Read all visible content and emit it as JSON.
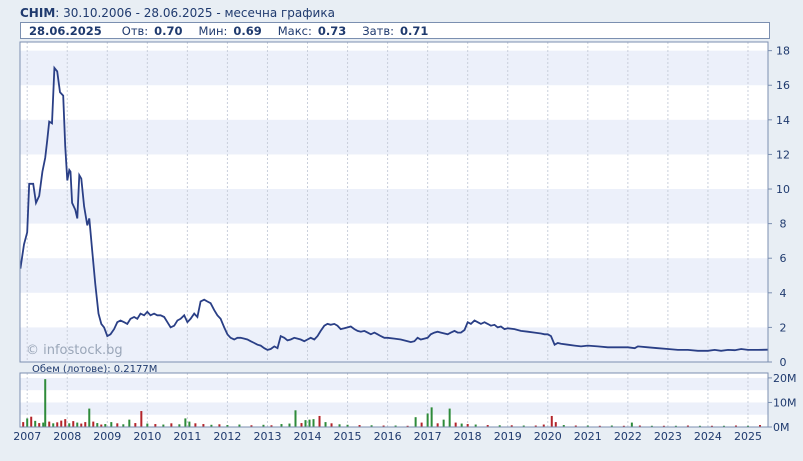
{
  "header": {
    "symbol": "CHIM",
    "range": "30.10.2006 - 28.06.2025",
    "chart_kind": "месечна графика"
  },
  "stats": {
    "date": "28.06.2025",
    "open_label": "Отв:",
    "open": "0.70",
    "min_label": "Мин:",
    "min": "0.69",
    "max_label": "Макс:",
    "max": "0.73",
    "close_label": "Затв:",
    "close": "0.71"
  },
  "watermark": "© infostock.bg",
  "volume_label": "Обем (лотове): 0.2177M",
  "colors": {
    "line": "#2a3f86",
    "vol_up": "#2e8b3a",
    "vol_down": "#b3242a",
    "band": "#ecf0fa",
    "frame": "#7b8fb0",
    "text": "#1f3a6e"
  },
  "chart_data": {
    "type": "line",
    "x_ticks": [
      "2007",
      "2008",
      "2009",
      "2010",
      "2011",
      "2012",
      "2013",
      "2014",
      "2015",
      "2016",
      "2017",
      "2018",
      "2019",
      "2020",
      "2021",
      "2022",
      "2023",
      "2024",
      "2025"
    ],
    "y_ticks": [
      "0",
      "2",
      "4",
      "6",
      "8",
      "10",
      "12",
      "14",
      "16",
      "18"
    ],
    "ylim": [
      0,
      18.5
    ],
    "xlim": [
      2006.82,
      2025.5
    ],
    "series": [
      {
        "values": [
          [
            2006.83,
            5.4
          ],
          [
            2006.92,
            6.8
          ],
          [
            2007.0,
            7.5
          ],
          [
            2007.05,
            10.3
          ],
          [
            2007.15,
            10.3
          ],
          [
            2007.22,
            9.2
          ],
          [
            2007.3,
            9.6
          ],
          [
            2007.38,
            11.0
          ],
          [
            2007.45,
            11.8
          ],
          [
            2007.5,
            12.8
          ],
          [
            2007.55,
            13.9
          ],
          [
            2007.62,
            13.8
          ],
          [
            2007.68,
            17.0
          ],
          [
            2007.75,
            16.8
          ],
          [
            2007.82,
            15.6
          ],
          [
            2007.9,
            15.4
          ],
          [
            2007.95,
            12.5
          ],
          [
            2008.0,
            10.5
          ],
          [
            2008.05,
            11.1
          ],
          [
            2008.08,
            11.0
          ],
          [
            2008.12,
            9.2
          ],
          [
            2008.2,
            8.8
          ],
          [
            2008.25,
            8.3
          ],
          [
            2008.3,
            10.8
          ],
          [
            2008.35,
            10.6
          ],
          [
            2008.42,
            9.0
          ],
          [
            2008.5,
            7.9
          ],
          [
            2008.55,
            8.3
          ],
          [
            2008.62,
            6.5
          ],
          [
            2008.7,
            4.5
          ],
          [
            2008.78,
            2.8
          ],
          [
            2008.85,
            2.2
          ],
          [
            2008.92,
            2.0
          ],
          [
            2009.0,
            1.5
          ],
          [
            2009.08,
            1.6
          ],
          [
            2009.17,
            1.9
          ],
          [
            2009.25,
            2.3
          ],
          [
            2009.33,
            2.4
          ],
          [
            2009.42,
            2.3
          ],
          [
            2009.5,
            2.2
          ],
          [
            2009.58,
            2.5
          ],
          [
            2009.67,
            2.6
          ],
          [
            2009.75,
            2.5
          ],
          [
            2009.83,
            2.8
          ],
          [
            2009.92,
            2.7
          ],
          [
            2010.0,
            2.9
          ],
          [
            2010.08,
            2.7
          ],
          [
            2010.17,
            2.8
          ],
          [
            2010.25,
            2.7
          ],
          [
            2010.33,
            2.7
          ],
          [
            2010.42,
            2.6
          ],
          [
            2010.5,
            2.3
          ],
          [
            2010.58,
            2.0
          ],
          [
            2010.67,
            2.1
          ],
          [
            2010.75,
            2.4
          ],
          [
            2010.83,
            2.5
          ],
          [
            2010.92,
            2.7
          ],
          [
            2011.0,
            2.3
          ],
          [
            2011.08,
            2.5
          ],
          [
            2011.17,
            2.8
          ],
          [
            2011.25,
            2.6
          ],
          [
            2011.33,
            3.5
          ],
          [
            2011.42,
            3.6
          ],
          [
            2011.5,
            3.5
          ],
          [
            2011.58,
            3.4
          ],
          [
            2011.67,
            3.0
          ],
          [
            2011.75,
            2.7
          ],
          [
            2011.83,
            2.5
          ],
          [
            2011.92,
            2.0
          ],
          [
            2012.0,
            1.6
          ],
          [
            2012.08,
            1.4
          ],
          [
            2012.17,
            1.3
          ],
          [
            2012.25,
            1.4
          ],
          [
            2012.33,
            1.4
          ],
          [
            2012.42,
            1.35
          ],
          [
            2012.5,
            1.3
          ],
          [
            2012.58,
            1.2
          ],
          [
            2012.67,
            1.1
          ],
          [
            2012.75,
            1.0
          ],
          [
            2012.83,
            0.95
          ],
          [
            2012.92,
            0.8
          ],
          [
            2013.0,
            0.7
          ],
          [
            2013.08,
            0.75
          ],
          [
            2013.17,
            0.9
          ],
          [
            2013.25,
            0.8
          ],
          [
            2013.33,
            1.5
          ],
          [
            2013.42,
            1.4
          ],
          [
            2013.5,
            1.25
          ],
          [
            2013.58,
            1.3
          ],
          [
            2013.67,
            1.4
          ],
          [
            2013.75,
            1.35
          ],
          [
            2013.83,
            1.3
          ],
          [
            2013.92,
            1.2
          ],
          [
            2014.0,
            1.3
          ],
          [
            2014.08,
            1.4
          ],
          [
            2014.17,
            1.3
          ],
          [
            2014.25,
            1.5
          ],
          [
            2014.33,
            1.8
          ],
          [
            2014.42,
            2.1
          ],
          [
            2014.5,
            2.2
          ],
          [
            2014.58,
            2.15
          ],
          [
            2014.67,
            2.2
          ],
          [
            2014.75,
            2.1
          ],
          [
            2014.83,
            1.9
          ],
          [
            2014.92,
            1.95
          ],
          [
            2015.0,
            2.0
          ],
          [
            2015.08,
            2.05
          ],
          [
            2015.17,
            1.9
          ],
          [
            2015.25,
            1.8
          ],
          [
            2015.33,
            1.75
          ],
          [
            2015.42,
            1.8
          ],
          [
            2015.5,
            1.7
          ],
          [
            2015.58,
            1.6
          ],
          [
            2015.67,
            1.7
          ],
          [
            2015.75,
            1.6
          ],
          [
            2015.83,
            1.5
          ],
          [
            2015.92,
            1.4
          ],
          [
            2016.0,
            1.4
          ],
          [
            2016.17,
            1.35
          ],
          [
            2016.33,
            1.3
          ],
          [
            2016.5,
            1.2
          ],
          [
            2016.58,
            1.15
          ],
          [
            2016.67,
            1.2
          ],
          [
            2016.75,
            1.4
          ],
          [
            2016.83,
            1.3
          ],
          [
            2016.92,
            1.35
          ],
          [
            2017.0,
            1.4
          ],
          [
            2017.08,
            1.6
          ],
          [
            2017.17,
            1.7
          ],
          [
            2017.25,
            1.75
          ],
          [
            2017.33,
            1.7
          ],
          [
            2017.42,
            1.65
          ],
          [
            2017.5,
            1.6
          ],
          [
            2017.58,
            1.7
          ],
          [
            2017.67,
            1.8
          ],
          [
            2017.75,
            1.7
          ],
          [
            2017.83,
            1.7
          ],
          [
            2017.92,
            1.85
          ],
          [
            2018.0,
            2.3
          ],
          [
            2018.08,
            2.2
          ],
          [
            2018.17,
            2.4
          ],
          [
            2018.25,
            2.3
          ],
          [
            2018.33,
            2.2
          ],
          [
            2018.42,
            2.3
          ],
          [
            2018.5,
            2.2
          ],
          [
            2018.58,
            2.1
          ],
          [
            2018.67,
            2.15
          ],
          [
            2018.75,
            2.0
          ],
          [
            2018.83,
            2.05
          ],
          [
            2018.92,
            1.9
          ],
          [
            2019.0,
            1.95
          ],
          [
            2019.17,
            1.9
          ],
          [
            2019.33,
            1.8
          ],
          [
            2019.5,
            1.75
          ],
          [
            2019.67,
            1.7
          ],
          [
            2019.83,
            1.65
          ],
          [
            2019.92,
            1.6
          ],
          [
            2020.0,
            1.6
          ],
          [
            2020.08,
            1.5
          ],
          [
            2020.17,
            1.0
          ],
          [
            2020.25,
            1.1
          ],
          [
            2020.33,
            1.05
          ],
          [
            2020.5,
            1.0
          ],
          [
            2020.67,
            0.95
          ],
          [
            2020.83,
            0.9
          ],
          [
            2021.0,
            0.95
          ],
          [
            2021.25,
            0.9
          ],
          [
            2021.5,
            0.85
          ],
          [
            2021.75,
            0.85
          ],
          [
            2022.0,
            0.85
          ],
          [
            2022.17,
            0.8
          ],
          [
            2022.25,
            0.9
          ],
          [
            2022.5,
            0.85
          ],
          [
            2022.75,
            0.8
          ],
          [
            2023.0,
            0.75
          ],
          [
            2023.25,
            0.7
          ],
          [
            2023.5,
            0.7
          ],
          [
            2023.75,
            0.65
          ],
          [
            2024.0,
            0.65
          ],
          [
            2024.17,
            0.7
          ],
          [
            2024.33,
            0.65
          ],
          [
            2024.5,
            0.7
          ],
          [
            2024.67,
            0.68
          ],
          [
            2024.83,
            0.75
          ],
          [
            2025.0,
            0.7
          ],
          [
            2025.25,
            0.7
          ],
          [
            2025.5,
            0.71
          ]
        ]
      }
    ],
    "volume": {
      "y_ticks": [
        "0M",
        "10M",
        "20M"
      ],
      "ylim": [
        0,
        22
      ],
      "bars": [
        [
          2006.9,
          2.0,
          "down"
        ],
        [
          2007.0,
          3.5,
          "up"
        ],
        [
          2007.1,
          4.2,
          "down"
        ],
        [
          2007.2,
          2.5,
          "up"
        ],
        [
          2007.3,
          1.6,
          "down"
        ],
        [
          2007.4,
          1.8,
          "up"
        ],
        [
          2007.45,
          19.5,
          "up"
        ],
        [
          2007.55,
          2.2,
          "down"
        ],
        [
          2007.65,
          1.5,
          "up"
        ],
        [
          2007.75,
          1.9,
          "down"
        ],
        [
          2007.85,
          2.6,
          "down"
        ],
        [
          2007.95,
          3.2,
          "down"
        ],
        [
          2008.05,
          1.5,
          "up"
        ],
        [
          2008.15,
          2.4,
          "down"
        ],
        [
          2008.25,
          1.8,
          "up"
        ],
        [
          2008.35,
          1.4,
          "down"
        ],
        [
          2008.45,
          2.0,
          "down"
        ],
        [
          2008.55,
          7.5,
          "up"
        ],
        [
          2008.65,
          2.2,
          "down"
        ],
        [
          2008.75,
          1.6,
          "up"
        ],
        [
          2008.85,
          1.0,
          "down"
        ],
        [
          2008.95,
          1.2,
          "up"
        ],
        [
          2009.1,
          2.0,
          "up"
        ],
        [
          2009.25,
          1.5,
          "down"
        ],
        [
          2009.4,
          1.1,
          "up"
        ],
        [
          2009.55,
          3.0,
          "up"
        ],
        [
          2009.7,
          1.6,
          "down"
        ],
        [
          2009.85,
          6.5,
          "down"
        ],
        [
          2010.0,
          1.4,
          "up"
        ],
        [
          2010.2,
          1.2,
          "down"
        ],
        [
          2010.4,
          1.0,
          "up"
        ],
        [
          2010.6,
          1.5,
          "down"
        ],
        [
          2010.8,
          1.1,
          "up"
        ],
        [
          2010.95,
          3.5,
          "up"
        ],
        [
          2011.05,
          2.2,
          "up"
        ],
        [
          2011.2,
          1.5,
          "down"
        ],
        [
          2011.4,
          1.2,
          "down"
        ],
        [
          2011.6,
          0.9,
          "up"
        ],
        [
          2011.8,
          1.1,
          "down"
        ],
        [
          2012.0,
          0.8,
          "up"
        ],
        [
          2012.3,
          1.0,
          "up"
        ],
        [
          2012.6,
          0.7,
          "down"
        ],
        [
          2012.9,
          0.9,
          "up"
        ],
        [
          2013.1,
          0.7,
          "down"
        ],
        [
          2013.35,
          1.2,
          "up"
        ],
        [
          2013.55,
          1.4,
          "up"
        ],
        [
          2013.7,
          6.8,
          "up"
        ],
        [
          2013.85,
          1.6,
          "down"
        ],
        [
          2013.95,
          2.8,
          "up"
        ],
        [
          2014.05,
          3.0,
          "up"
        ],
        [
          2014.15,
          3.2,
          "up"
        ],
        [
          2014.3,
          4.5,
          "down"
        ],
        [
          2014.45,
          2.0,
          "up"
        ],
        [
          2014.6,
          1.5,
          "down"
        ],
        [
          2014.8,
          1.1,
          "up"
        ],
        [
          2015.0,
          0.9,
          "up"
        ],
        [
          2015.3,
          0.8,
          "down"
        ],
        [
          2015.6,
          0.7,
          "up"
        ],
        [
          2015.9,
          0.6,
          "down"
        ],
        [
          2016.2,
          0.6,
          "up"
        ],
        [
          2016.5,
          0.5,
          "down"
        ],
        [
          2016.7,
          4.0,
          "up"
        ],
        [
          2016.85,
          1.8,
          "down"
        ],
        [
          2017.0,
          5.5,
          "up"
        ],
        [
          2017.1,
          8.0,
          "up"
        ],
        [
          2017.25,
          1.5,
          "down"
        ],
        [
          2017.4,
          3.0,
          "up"
        ],
        [
          2017.55,
          7.5,
          "up"
        ],
        [
          2017.7,
          1.8,
          "down"
        ],
        [
          2017.85,
          1.4,
          "up"
        ],
        [
          2018.0,
          1.2,
          "down"
        ],
        [
          2018.2,
          1.0,
          "up"
        ],
        [
          2018.5,
          0.8,
          "down"
        ],
        [
          2018.8,
          0.7,
          "up"
        ],
        [
          2019.1,
          0.7,
          "down"
        ],
        [
          2019.4,
          0.6,
          "up"
        ],
        [
          2019.7,
          0.6,
          "down"
        ],
        [
          2019.9,
          1.0,
          "down"
        ],
        [
          2020.1,
          4.5,
          "down"
        ],
        [
          2020.2,
          2.0,
          "down"
        ],
        [
          2020.4,
          0.8,
          "up"
        ],
        [
          2020.7,
          0.6,
          "down"
        ],
        [
          2021.0,
          0.6,
          "up"
        ],
        [
          2021.3,
          0.5,
          "down"
        ],
        [
          2021.6,
          0.6,
          "up"
        ],
        [
          2021.9,
          0.5,
          "down"
        ],
        [
          2022.1,
          1.8,
          "up"
        ],
        [
          2022.3,
          0.6,
          "down"
        ],
        [
          2022.6,
          0.5,
          "up"
        ],
        [
          2022.9,
          0.5,
          "down"
        ],
        [
          2023.2,
          0.5,
          "up"
        ],
        [
          2023.5,
          0.6,
          "down"
        ],
        [
          2023.8,
          0.5,
          "up"
        ],
        [
          2024.1,
          0.5,
          "down"
        ],
        [
          2024.4,
          0.5,
          "up"
        ],
        [
          2024.7,
          0.6,
          "down"
        ],
        [
          2025.0,
          0.5,
          "up"
        ],
        [
          2025.3,
          0.8,
          "down"
        ]
      ]
    }
  }
}
